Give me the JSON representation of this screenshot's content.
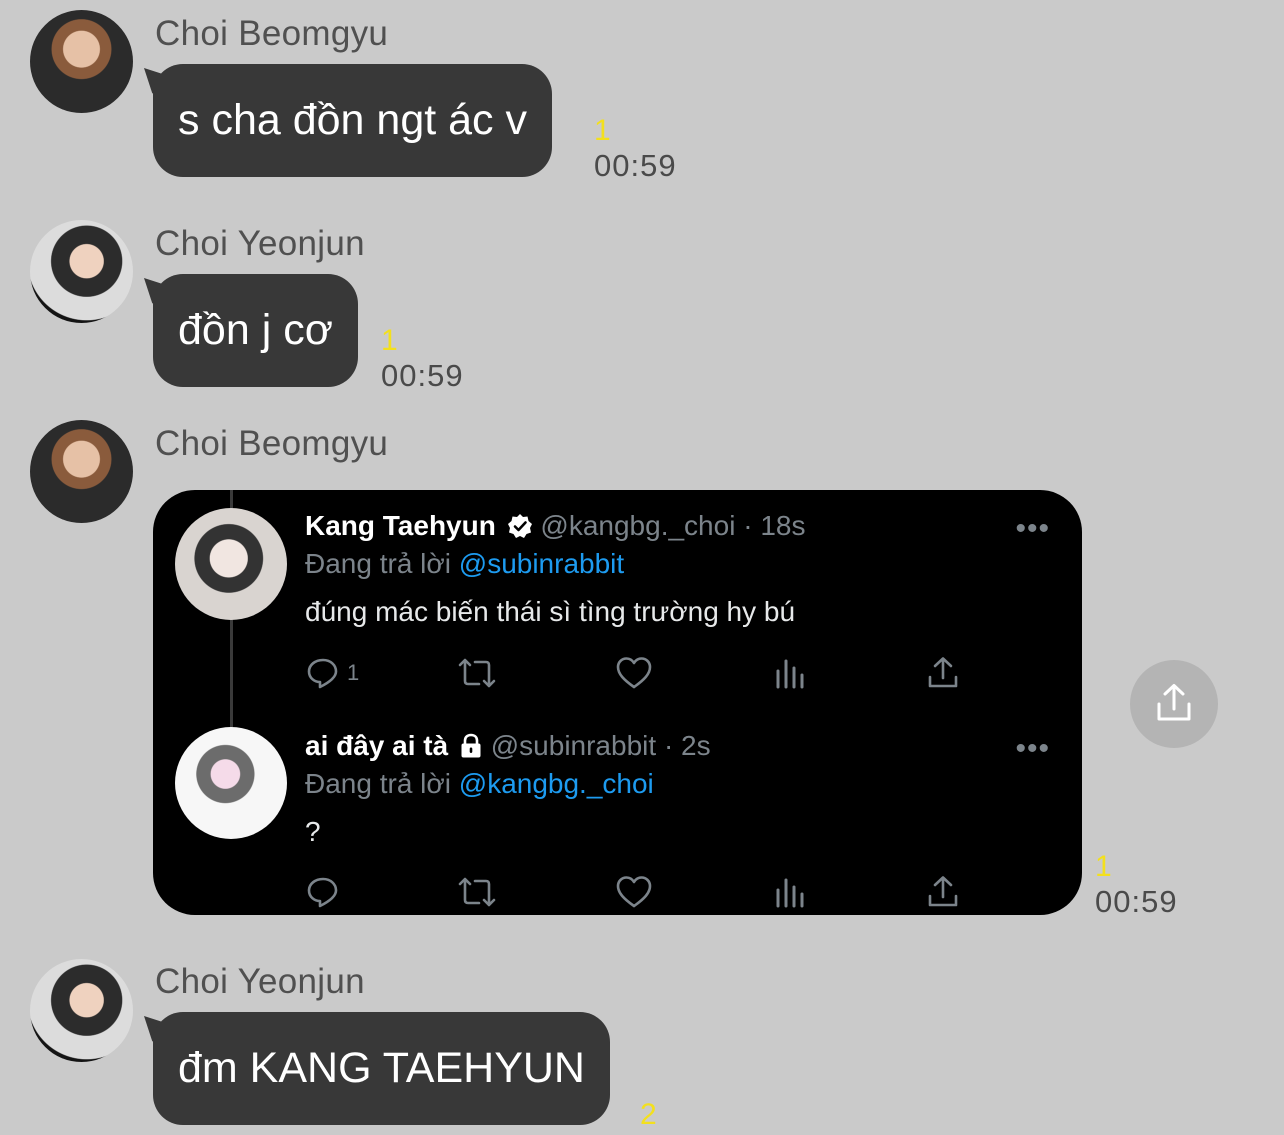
{
  "messages": [
    {
      "sender": "Choi Beomgyu",
      "text": "s cha đồn ngt ác v",
      "unread": "1",
      "time": "00:59"
    },
    {
      "sender": "Choi Yeonjun",
      "text": "đồn j cơ",
      "unread": "1",
      "time": "00:59"
    },
    {
      "sender": "Choi Beomgyu",
      "unread": "1",
      "time": "00:59",
      "tweets": [
        {
          "name": "Kang Taehyun",
          "verified": true,
          "handle": "@kangbg._choi",
          "age": "18s",
          "reply_prefix": "Đang trả lời",
          "reply_to": "@subinrabbit",
          "text": "đúng mác biến thái sì tìng trường hy bú",
          "reply_count": "1",
          "more": "•••"
        },
        {
          "name": "ai đây ai tà",
          "locked": true,
          "handle": "@subinrabbit",
          "age": "2s",
          "reply_prefix": "Đang trả lời",
          "reply_to": "@kangbg._choi",
          "text": "?",
          "reply_count": "",
          "more": "•••"
        }
      ]
    },
    {
      "sender": "Choi Yeonjun",
      "text": "đm KANG TAEHYUN",
      "unread": "2"
    }
  ],
  "icons": [
    "reply-icon",
    "retweet-icon",
    "like-icon",
    "analytics-icon",
    "share-icon",
    "verified-icon",
    "lock-icon"
  ],
  "colors": {
    "bubble": "#383838",
    "background": "#cacaca",
    "unread": "#f3e01d",
    "mention": "#1d9bf0"
  }
}
